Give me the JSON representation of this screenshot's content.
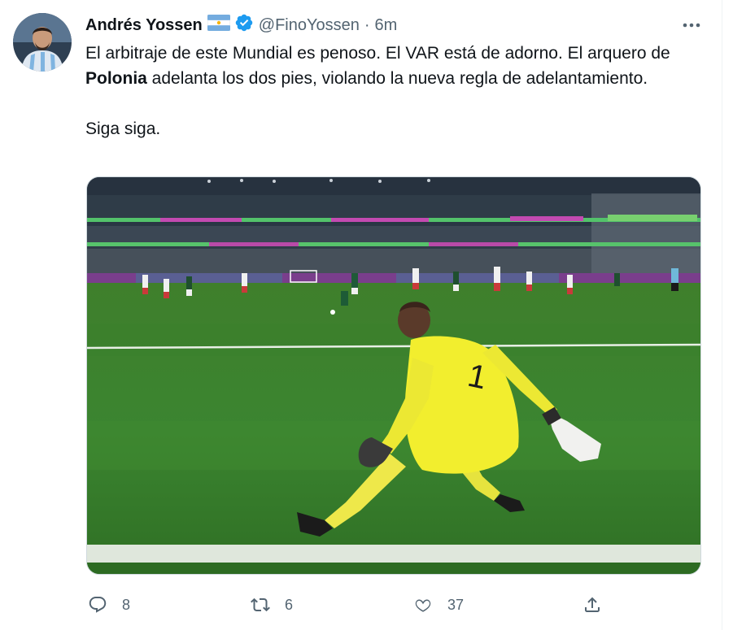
{
  "tweet": {
    "author_name": "Andrés Yossen",
    "author_handle": "@FinoYossen",
    "separator": "·",
    "timestamp": "6m",
    "text_part1": "El arbitraje de este Mundial es penoso. El VAR está de adorno. El arquero de ",
    "text_bold": "Polonia",
    "text_part2": " adelanta los dos pies, violando la nueva regla de adelantamiento.",
    "text_line2": "Siga siga.",
    "flag_icon": "argentina-flag-icon",
    "verified_icon": "verified-badge-icon",
    "media_description_icon": "penalty-goalkeeper-photo",
    "jersey_number": "1"
  },
  "actions": {
    "reply": {
      "icon": "reply-icon",
      "count": "8"
    },
    "retweet": {
      "icon": "retweet-icon",
      "count": "6"
    },
    "like": {
      "icon": "heart-icon",
      "count": "37"
    },
    "share": {
      "icon": "share-icon"
    }
  },
  "colors": {
    "text": "#0f1419",
    "secondary": "#536471",
    "verified": "#1d9bf0",
    "keeper_kit": "#f2ee2e",
    "pitch": "#3f8a2f"
  }
}
